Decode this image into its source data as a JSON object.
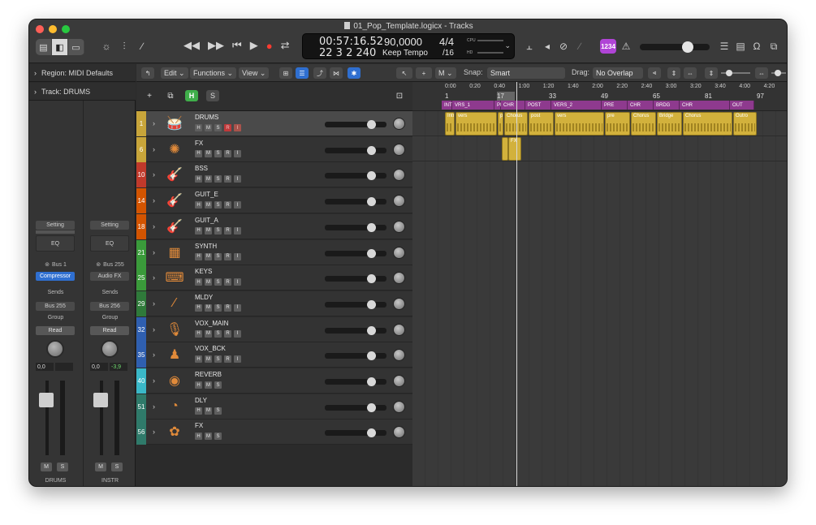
{
  "window": {
    "title": "01_Pop_Template.logicx - Tracks"
  },
  "lcd": {
    "time": "00:57:16.52",
    "bars": "22  3  2 240",
    "tempo": "90,0000",
    "tempo_mode": "Keep Tempo",
    "signature": "4/4",
    "division": "/16",
    "cpu_label": "CPU",
    "hd_label": "HD"
  },
  "controlbar": {
    "count_in_label": "1234"
  },
  "inspector": {
    "region_header": "Region: MIDI Defaults",
    "track_header": "Track: DRUMS",
    "strips": [
      {
        "setting": "Setting",
        "eq": "EQ",
        "input": "Bus 1",
        "audio_fx": "Compressor",
        "sends": "Sends",
        "output": "Bus 255",
        "group": "Group",
        "automation": "Read",
        "vol": "0,0",
        "peak": "",
        "mute": "M",
        "solo": "S",
        "name": "DRUMS"
      },
      {
        "setting": "Setting",
        "eq": "EQ",
        "input": "Bus 255",
        "audio_fx": "Audio FX",
        "sends": "Sends",
        "output": "Bus 256",
        "group": "Group",
        "automation": "Read",
        "vol": "0,0",
        "peak": "-3,9",
        "mute": "M",
        "solo": "S",
        "name": "INSTR"
      }
    ]
  },
  "toolbar": {
    "edit": "Edit",
    "functions": "Functions",
    "view": "View",
    "snap_label": "Snap:",
    "snap_value": "Smart",
    "drag_label": "Drag:",
    "drag_value": "No Overlap",
    "m_label": "M"
  },
  "tracklist_header": {
    "h_label": "H",
    "s_label": "S"
  },
  "tracks": [
    {
      "num": "1",
      "name": "DRUMS",
      "color": "#c8a53a",
      "icon": "drum-kit-icon",
      "buttons": [
        "H",
        "M",
        "S",
        "R",
        "I"
      ],
      "selected": true
    },
    {
      "num": "6",
      "name": "FX",
      "color": "#c8a53a",
      "icon": "spark-icon",
      "buttons": [
        "H",
        "M",
        "S",
        "R",
        "I"
      ]
    },
    {
      "num": "10",
      "name": "BSS",
      "color": "#c0392b",
      "icon": "bass-guitar-icon",
      "buttons": [
        "H",
        "M",
        "S",
        "R",
        "I"
      ]
    },
    {
      "num": "14",
      "name": "GUIT_E",
      "color": "#d35400",
      "icon": "guitar-icon",
      "buttons": [
        "H",
        "M",
        "S",
        "R",
        "I"
      ]
    },
    {
      "num": "18",
      "name": "GUIT_A",
      "color": "#d35400",
      "icon": "guitar-icon",
      "buttons": [
        "H",
        "M",
        "S",
        "R",
        "I"
      ]
    },
    {
      "num": "21",
      "name": "SYNTH",
      "color": "#3a9a3a",
      "icon": "synth-icon",
      "buttons": [
        "H",
        "M",
        "S",
        "R",
        "I"
      ]
    },
    {
      "num": "25",
      "name": "KEYS",
      "color": "#3a9a3a",
      "icon": "keys-icon",
      "buttons": [
        "H",
        "M",
        "S",
        "R",
        "I"
      ]
    },
    {
      "num": "29",
      "name": "MLDY",
      "color": "#2f7a3a",
      "icon": "flute-icon",
      "buttons": [
        "H",
        "M",
        "S",
        "R",
        "I"
      ]
    },
    {
      "num": "32",
      "name": "VOX_MAIN",
      "color": "#2f5fb0",
      "icon": "microphone-icon",
      "buttons": [
        "H",
        "M",
        "S",
        "R",
        "I"
      ]
    },
    {
      "num": "35",
      "name": "VOX_BCK",
      "color": "#2f5fb0",
      "icon": "choir-icon",
      "buttons": [
        "H",
        "M",
        "S",
        "R",
        "I"
      ]
    },
    {
      "num": "40",
      "name": "REVERB",
      "color": "#3ab8c8",
      "icon": "reverb-icon",
      "buttons": [
        "H",
        "M",
        "S"
      ]
    },
    {
      "num": "51",
      "name": "DLY",
      "color": "#2f7a6a",
      "icon": "delay-icon",
      "buttons": [
        "H",
        "M",
        "S"
      ]
    },
    {
      "num": "56",
      "name": "FX",
      "color": "#2f7a6a",
      "icon": "fx-icon",
      "buttons": [
        "H",
        "M",
        "S"
      ]
    }
  ],
  "ruler": {
    "times": [
      "0:00",
      "0:20",
      "0:40",
      "1:00",
      "1:20",
      "1:40",
      "2:00",
      "2:20",
      "2:40",
      "3:00",
      "3:20",
      "3:40",
      "4:00",
      "4:20"
    ],
    "bars": [
      "1",
      "17",
      "33",
      "49",
      "65",
      "81",
      "97"
    ]
  },
  "markers": [
    "INT",
    "VRS_1",
    "PI",
    "CHR",
    "POST",
    "VERS_2",
    "PRE",
    "CHR",
    "BRDG",
    "CHR",
    "OUT"
  ],
  "drum_regions": [
    "Intr",
    "vers",
    "pr",
    "Chorus",
    "post",
    "vers",
    "pre",
    "Chorus",
    "Bridge",
    "Chorus",
    "Outro"
  ],
  "fx_regions": [
    "",
    "FX"
  ],
  "colors": {
    "accent_blue": "#2f6fd0",
    "region_yellow": "#d2b13c",
    "marker_purple": "#8e3a8e"
  }
}
